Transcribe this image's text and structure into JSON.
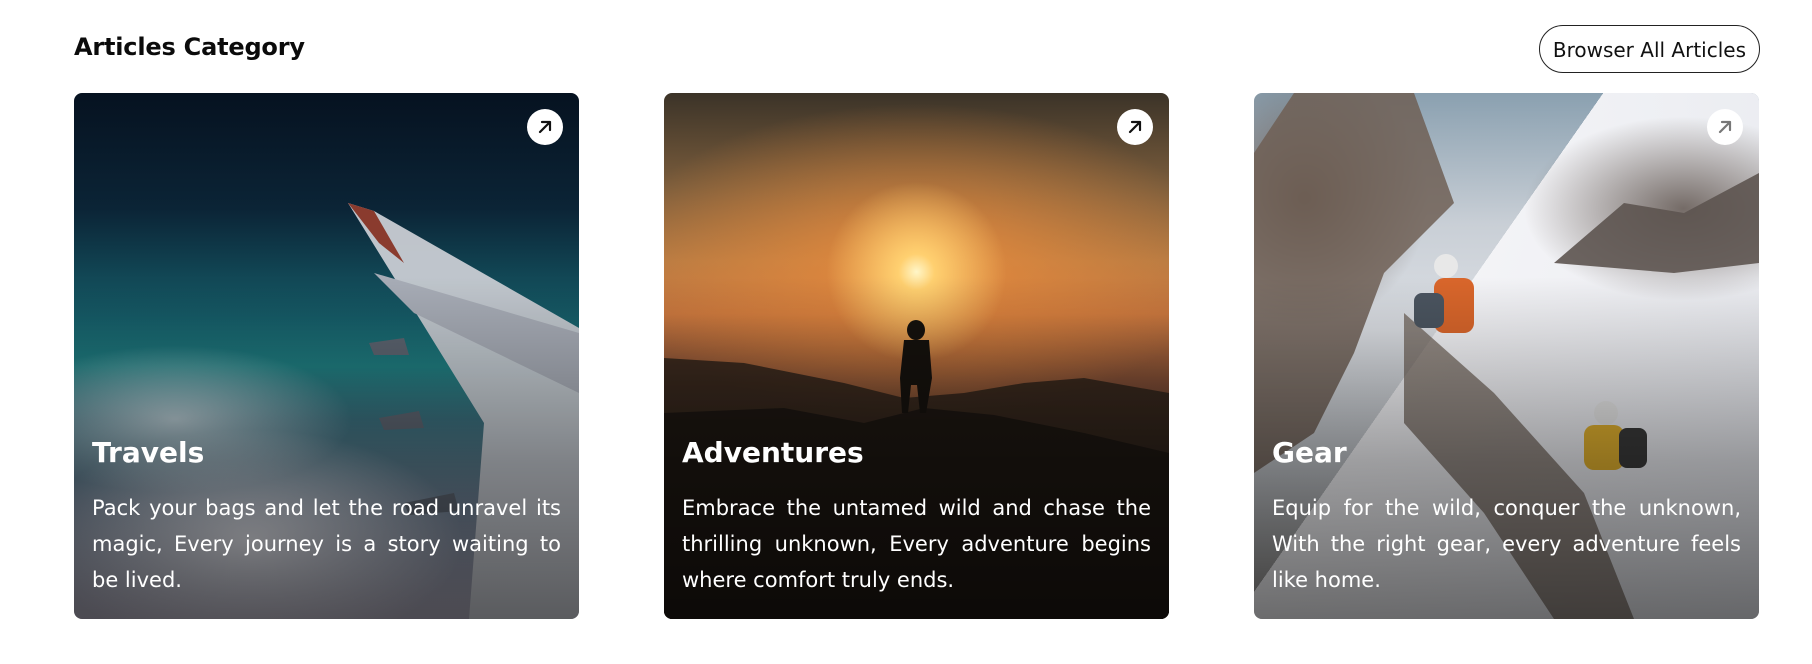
{
  "section": {
    "title": "Articles Category",
    "browse_label": "Browser All Articles"
  },
  "cards": [
    {
      "title": "Travels",
      "description": "Pack your bags and let the road unravel its magic, Every journey is a story waiting to be lived.",
      "link_icon": "arrow-up-right-icon"
    },
    {
      "title": "Adventures",
      "description": "Embrace the untamed wild and chase the thrilling unknown, Every adventure begins where comfort truly ends.",
      "link_icon": "arrow-up-right-icon"
    },
    {
      "title": "Gear",
      "description": "Equip for the wild, conquer the unknown, With the right gear, every adventure feels like home.",
      "link_icon": "arrow-up-right-icon"
    }
  ],
  "colors": {
    "text": "#111111",
    "card_text": "#ffffff",
    "button_border": "#222222"
  }
}
